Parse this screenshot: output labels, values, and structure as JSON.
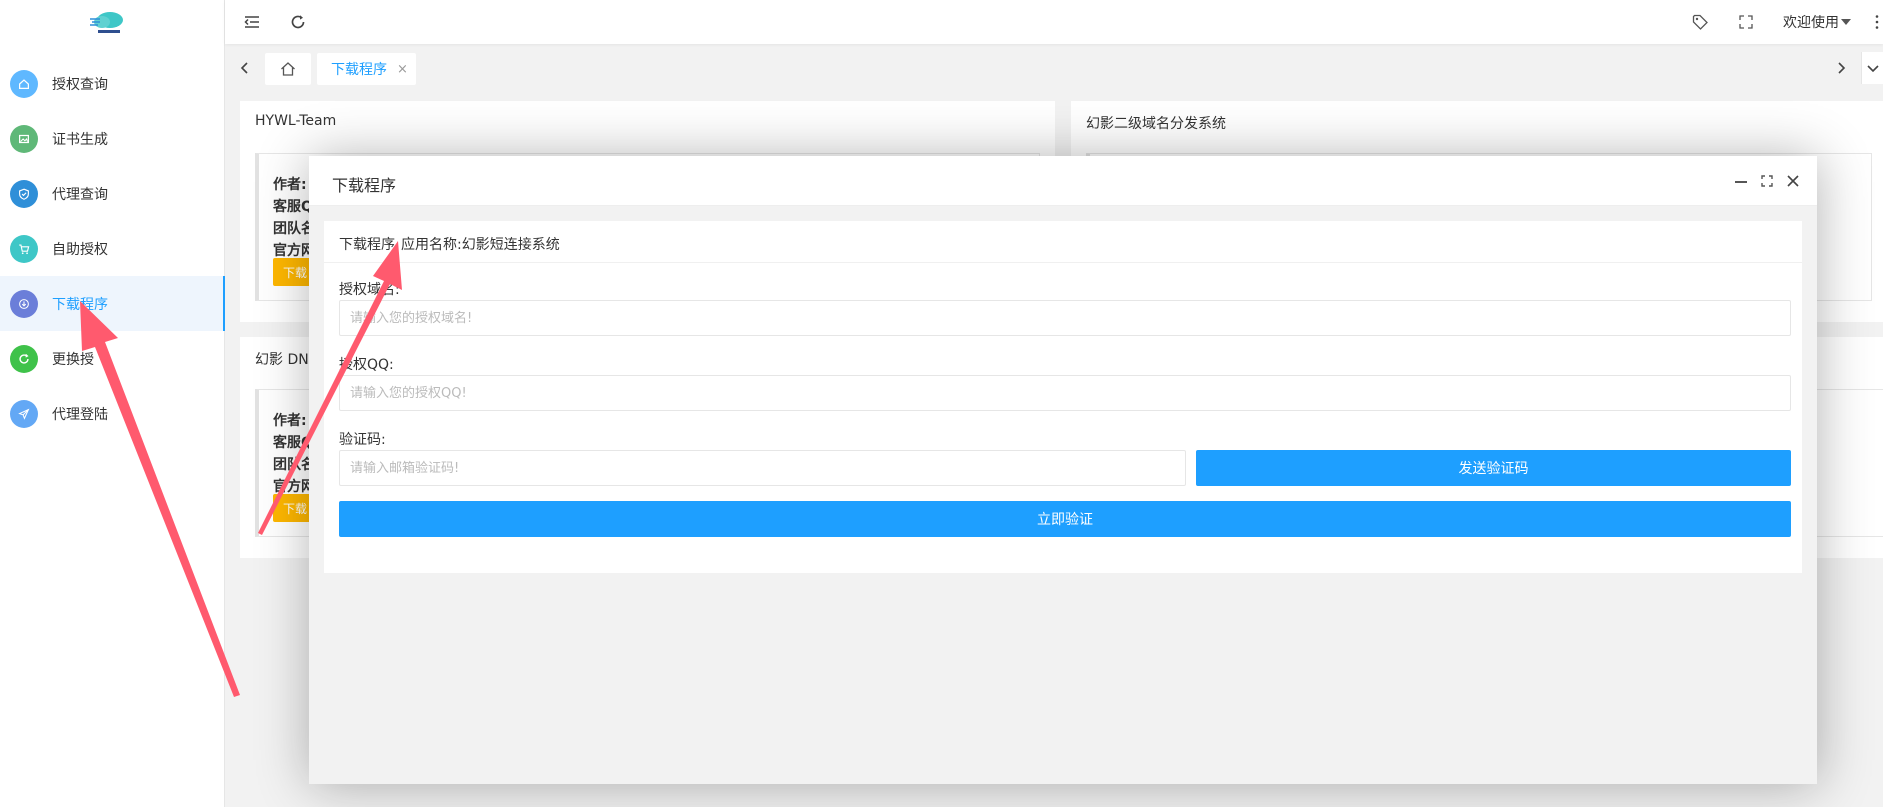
{
  "sidebar": {
    "items": [
      {
        "label": "授权查询",
        "icon": "home-icon",
        "color": "#5fb8ff"
      },
      {
        "label": "证书生成",
        "icon": "image-icon",
        "color": "#5fb878"
      },
      {
        "label": "代理查询",
        "icon": "shield-icon",
        "color": "#2f8fd8"
      },
      {
        "label": "自助授权",
        "icon": "cart-icon",
        "color": "#3ec7c7"
      },
      {
        "label": "下载程序",
        "icon": "download-icon",
        "color": "#6b7ed9"
      },
      {
        "label": "更换授",
        "icon": "refresh-icon",
        "color": "#3fc24a"
      },
      {
        "label": "代理登陆",
        "icon": "send-icon",
        "color": "#63a8f5"
      }
    ],
    "active_index": 4
  },
  "header": {
    "welcome": "欢迎使用"
  },
  "tabs": {
    "active_label": "下载程序",
    "close_glyph": "×"
  },
  "cards": {
    "card1_title": "HYWL-Team",
    "card2_title": "幻影二级域名分发系统",
    "card3_title": "幻影 DNS",
    "lines": [
      "作者:",
      "客服Q",
      "团队名",
      "官方网"
    ],
    "btn_label": "下载"
  },
  "modal": {
    "title": "下载程序",
    "panel_head_a": "下载程序",
    "panel_head_b": "应用名称:幻影短连接系统",
    "domain_label": "授权域名:",
    "domain_placeholder": "请输入您的授权域名!",
    "qq_label": "授权QQ:",
    "qq_placeholder": "请输入您的授权QQ!",
    "code_label": "验证码:",
    "code_placeholder": "请输入邮箱验证码!",
    "send_code_button": "发送验证码",
    "verify_button": "立即验证"
  },
  "colors": {
    "primary": "#1e9fff",
    "warning": "#ffb800",
    "annotation": "#ff5a6e"
  }
}
